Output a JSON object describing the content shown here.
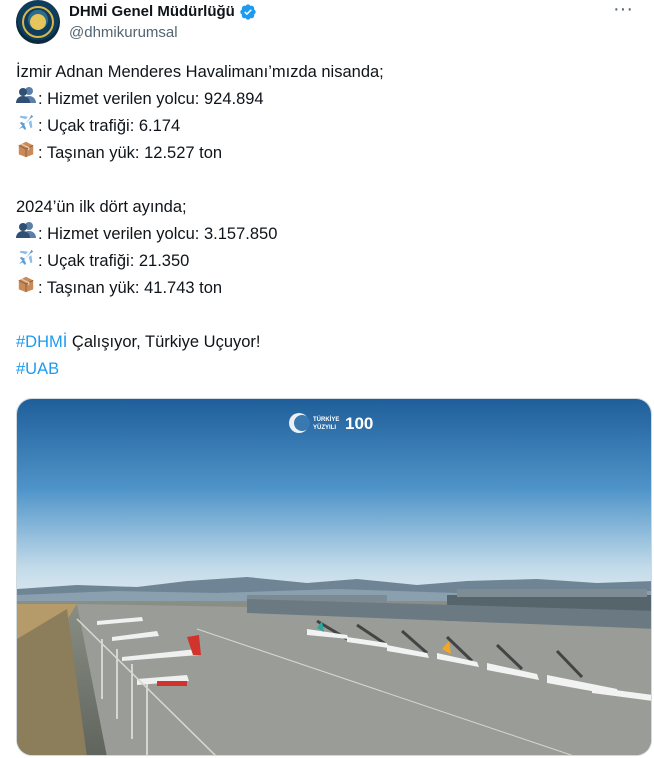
{
  "author": {
    "display_name": "DHMİ Genel Müdürlüğü",
    "handle": "@dhmikurumsal",
    "verified": true
  },
  "tweet": {
    "intro": "İzmir Adnan Menderes Havalimanı’mızda nisanda;",
    "april": [
      {
        "icon": "passengers-icon",
        "text": ": Hizmet verilen yolcu: 924.894"
      },
      {
        "icon": "airplane-icon",
        "text": ": Uçak trafiği: 6.174"
      },
      {
        "icon": "package-icon",
        "text": ": Taşınan yük: 12.527 ton"
      }
    ],
    "period_intro": "2024’ün ilk dört ayında;",
    "four_months": [
      {
        "icon": "passengers-icon",
        "text": ": Hizmet verilen yolcu: 3.157.850"
      },
      {
        "icon": "airplane-icon",
        "text": ": Uçak trafiği: 21.350"
      },
      {
        "icon": "package-icon",
        "text": ": Taşınan yük: 41.743 ton"
      }
    ],
    "hashtag1": "#DHMİ",
    "slogan": " Çalışıyor, Türkiye Uçuyor!",
    "hashtag2": "#UAB"
  },
  "media": {
    "overlay_text_1": "TÜRKİYE",
    "overlay_text_2": "YÜZYILI",
    "overlay_logo": "100"
  },
  "colors": {
    "link": "#1d9bf0",
    "verified": "#1d9bf0",
    "secondary": "#536471"
  }
}
